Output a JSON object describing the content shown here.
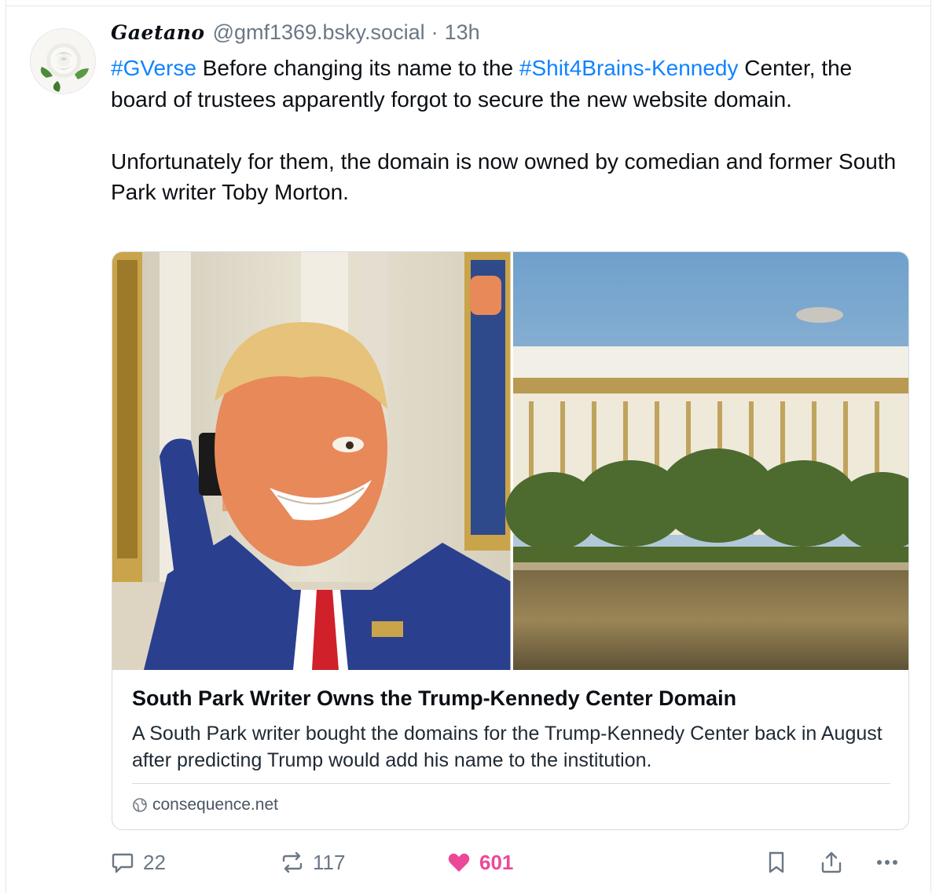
{
  "post": {
    "author": {
      "display_name": "Gaetano",
      "handle": "@gmf1369.bsky.social",
      "separator": "·",
      "time": "13h"
    },
    "text": {
      "p1_tag1": "#GVerse",
      "p1_mid": " Before changing its name to the ",
      "p1_tag2": "#Shit4Brains-Kennedy",
      "p1_end": " Center, the board of trustees apparently forgot to secure the new website domain.",
      "p2": "Unfortunately for them, the domain is now owned by comedian and former South Park writer Toby Morton."
    },
    "link_card": {
      "title": "South Park Writer Owns the Trump-Kennedy Center Domain",
      "description": "A South Park writer bought the domains for the Trump-Kennedy Center back in August after predicting Trump would add his name to the institution.",
      "domain": "consequence.net",
      "domain_icon": "globe-icon"
    },
    "actions": {
      "replies": "22",
      "reposts": "117",
      "likes": "601",
      "icons": [
        "reply-icon",
        "repost-icon",
        "heart-icon",
        "bookmark-icon",
        "share-icon",
        "more-icon"
      ]
    }
  },
  "colors": {
    "link": "#1083fe",
    "like": "#ec4899",
    "muted": "#6b7785",
    "border": "#d4dbe2"
  }
}
